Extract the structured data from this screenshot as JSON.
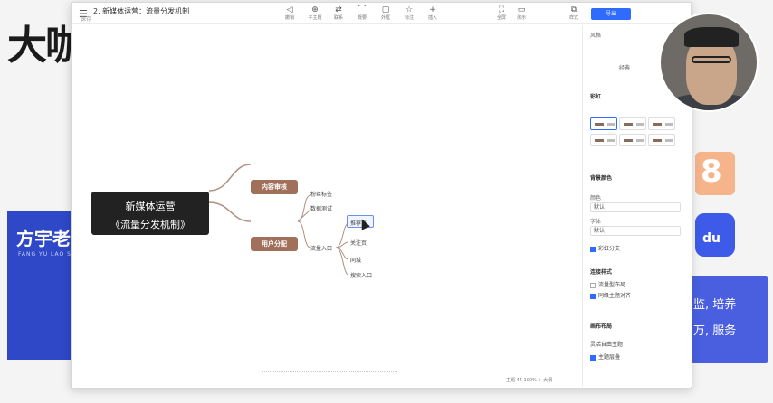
{
  "background": {
    "title": "大咖",
    "blue_card_name": "方宇老",
    "blue_card_sub": "FANG YU LAO SHI",
    "right_card_line1": "监, 培养",
    "right_card_line2": "万, 服务",
    "icon_top_text": "8",
    "icon_bottom_text": "du"
  },
  "window": {
    "title": "2. 新媒体运营：流量分发机制",
    "subtitle": "保存",
    "export_label": "导出",
    "toolbar": [
      {
        "icon": "◁",
        "label": "撤销"
      },
      {
        "icon": "⊕",
        "label": "子主题"
      },
      {
        "icon": "⇄",
        "label": "联系"
      },
      {
        "icon": "⌒",
        "label": "概要"
      },
      {
        "icon": "▢",
        "label": "外框"
      },
      {
        "icon": "☆",
        "label": "标注"
      },
      {
        "icon": "+",
        "label": "插入"
      }
    ],
    "toolbar_right": [
      {
        "icon": "⛶",
        "label": "全屏"
      },
      {
        "icon": "▭",
        "label": "演示"
      },
      {
        "icon": "⧉",
        "label": "样式"
      }
    ]
  },
  "mindmap": {
    "root_line1": "新媒体运营",
    "root_line2": "《流量分发机制》",
    "branch1": "内容审核",
    "branch2": "用户分配",
    "leaves": [
      "粉丝标签",
      "数据测试",
      "流量入口",
      "推荐页",
      "关注页",
      "同城",
      "搜索入口"
    ]
  },
  "status": "主题 44   100%  +  大纲",
  "panel": {
    "style_label": "风格",
    "theme_name": "经典",
    "theme_select": "彩虹",
    "bg_color_label": "背景颜色",
    "color_label": "颜色",
    "color_value": "默认",
    "font_label": "字体",
    "font_value": "默认",
    "rainbow_branch": "彩虹分支",
    "connector_label": "连接样式",
    "connector_opt1": "流量型布局",
    "connector_opt2": "同级主题对齐",
    "layout_label": "画布布局",
    "layout_opt1": "灵活自由主题",
    "layout_opt2": "主题层叠"
  },
  "colors": {
    "accent": "#2f6bff",
    "branch": "#a0705a",
    "root": "#222222",
    "slide_blue": "#2f48c8"
  }
}
